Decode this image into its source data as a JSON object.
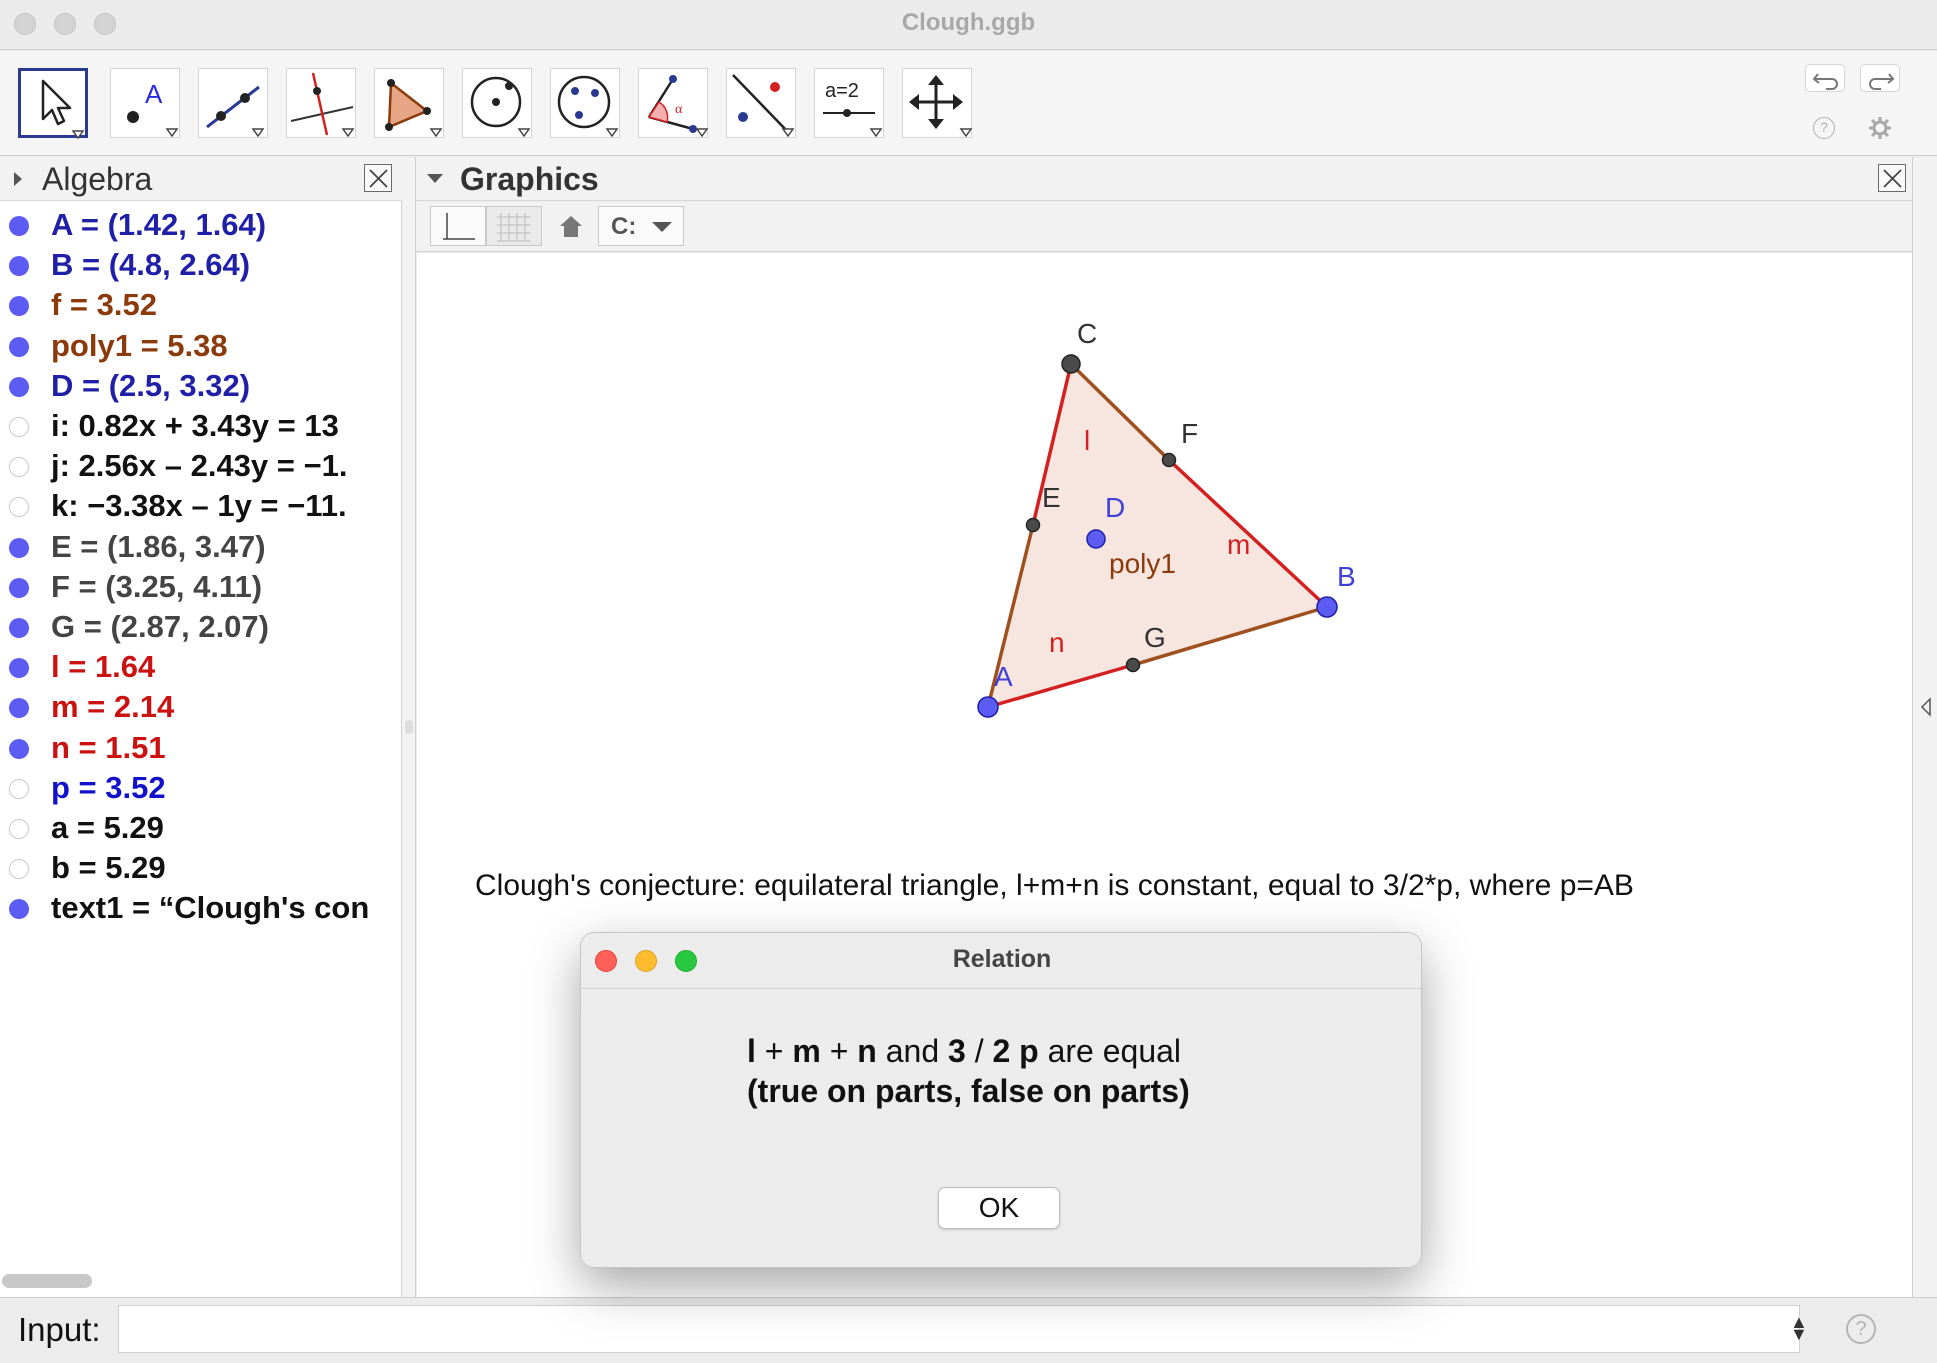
{
  "window": {
    "title": "Clough.ggb"
  },
  "toolbar": {
    "tools": [
      "move-tool-icon",
      "point-tool-icon",
      "line-tool-icon",
      "perpendicular-line-tool-icon",
      "polygon-tool-icon",
      "circle-tool-icon",
      "circle-three-points-tool-icon",
      "angle-tool-icon",
      "reflect-tool-icon",
      "slider-tool-icon",
      "move-graphics-view-tool-icon"
    ],
    "slider_icon_text": "a=2",
    "selected_tool": "move-tool-icon",
    "undo_icon": "undo-icon",
    "redo_icon": "redo-icon",
    "help_icon": "help-icon",
    "settings_icon": "gear-icon"
  },
  "algebra": {
    "title": "Algebra",
    "rows": [
      {
        "text": "A = (1.42, 1.64)",
        "color": "#1f1fa8",
        "visible": true
      },
      {
        "text": "B = (4.8, 2.64)",
        "color": "#1f1fa8",
        "visible": true
      },
      {
        "text": "f = 3.52",
        "color": "#8b3a0c",
        "visible": true
      },
      {
        "text": "poly1 = 5.38",
        "color": "#8b3a0c",
        "visible": true
      },
      {
        "text": "D = (2.5, 3.32)",
        "color": "#1f1fa8",
        "visible": true
      },
      {
        "text": "i: 0.82x + 3.43y = 13",
        "color": "#111111",
        "visible": false
      },
      {
        "text": "j: 2.56x – 2.43y = −1.",
        "color": "#111111",
        "visible": false
      },
      {
        "text": "k: −3.38x – 1y = −11.",
        "color": "#111111",
        "visible": false
      },
      {
        "text": "E = (1.86, 3.47)",
        "color": "#444444",
        "visible": true
      },
      {
        "text": "F = (3.25, 4.11)",
        "color": "#444444",
        "visible": true
      },
      {
        "text": "G = (2.87, 2.07)",
        "color": "#444444",
        "visible": true
      },
      {
        "text": "l = 1.64",
        "color": "#cc1111",
        "visible": true
      },
      {
        "text": "m = 2.14",
        "color": "#cc1111",
        "visible": true
      },
      {
        "text": "n = 1.51",
        "color": "#cc1111",
        "visible": true
      },
      {
        "text": "p = 3.52",
        "color": "#1111cc",
        "visible": false
      },
      {
        "text": "a = 5.29",
        "color": "#111111",
        "visible": false
      },
      {
        "text": "b = 5.29",
        "color": "#111111",
        "visible": false
      },
      {
        "text": "text1 = “Clough's con",
        "color": "#111111",
        "visible": true
      }
    ]
  },
  "graphics": {
    "title": "Graphics",
    "style_bar": {
      "axes_icon": "axes-toggle-icon",
      "grid_icon": "grid-toggle-icon",
      "home_icon": "home-icon",
      "point_capture_label": "C:"
    },
    "labels": {
      "C": "C",
      "F": "F",
      "E": "E",
      "D": "D",
      "B": "B",
      "G": "G",
      "A": "A",
      "l": "l",
      "m": "m",
      "n": "n",
      "poly1": "poly1"
    },
    "conjecture_text": "Clough's conjecture: equilateral triangle, l+m+n is constant, equal to 3/2*p, where p=AB",
    "colors": {
      "free_point": "#5c5cf2",
      "dependent_point": "#4a4a4a",
      "segment_red": "#d42020",
      "segment_brown": "#a0501e",
      "polygon_fill": "#f7e6df",
      "blue_label": "#4040d8",
      "brown_label": "#8b3a0c"
    }
  },
  "dialog": {
    "title": "Relation",
    "line1": {
      "l": "l",
      "plus1": " + ",
      "m": "m",
      "plus2": " + ",
      "n": "n",
      "and": " and ",
      "three": "3",
      "slash": " / ",
      "two": "2",
      "space": " ",
      "p": "p",
      "are_equal": " are equal"
    },
    "line2": "(true on parts, false on parts)",
    "ok_label": "OK"
  },
  "input": {
    "label": "Input:",
    "value": "",
    "help_icon": "help-icon"
  }
}
